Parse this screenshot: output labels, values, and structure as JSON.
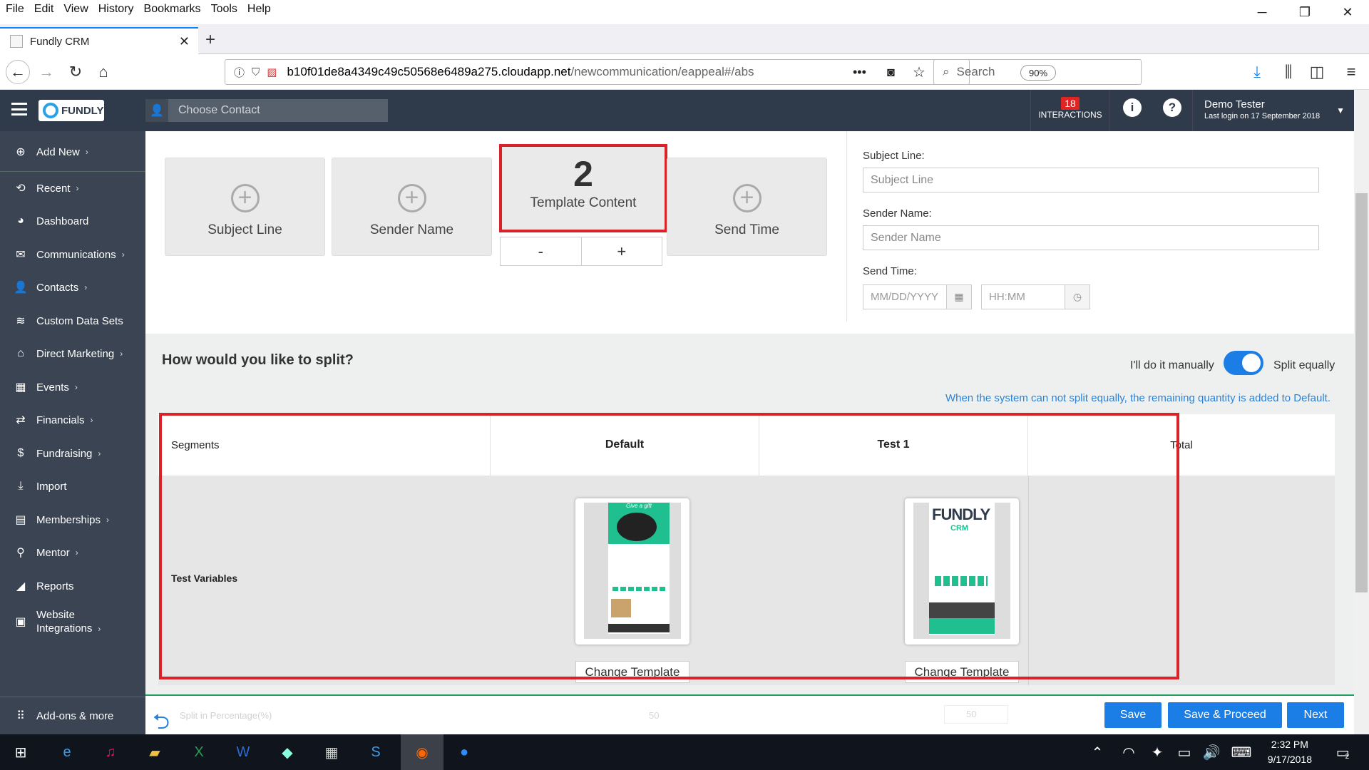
{
  "browser": {
    "menu": [
      "File",
      "Edit",
      "View",
      "History",
      "Bookmarks",
      "Tools",
      "Help"
    ],
    "tab_title": "Fundly CRM",
    "url_host": "b10f01de8a4349c49c50568e6489a275.cloudapp.net",
    "url_path": "/newcommunication/eappeal#/abs",
    "zoom": "90%",
    "search_placeholder": "Search",
    "window_controls": [
      "─",
      "❐",
      "✕"
    ]
  },
  "header": {
    "logo": "FUNDLY",
    "contact_placeholder": "Choose Contact",
    "interactions_count": "18",
    "interactions_label": "INTERACTIONS",
    "user_name": "Demo Tester",
    "last_login": "Last login on 17 September 2018"
  },
  "sidebar": {
    "items": [
      {
        "label": "Add New",
        "icon": "plus-circle-icon",
        "chevron": true
      },
      {
        "label": "Recent",
        "icon": "history-icon",
        "chevron": true
      },
      {
        "label": "Dashboard",
        "icon": "dashboard-icon",
        "chevron": false
      },
      {
        "label": "Communications",
        "icon": "envelope-icon",
        "chevron": true
      },
      {
        "label": "Contacts",
        "icon": "user-icon",
        "chevron": true
      },
      {
        "label": "Custom Data Sets",
        "icon": "database-icon",
        "chevron": false
      },
      {
        "label": "Direct Marketing",
        "icon": "bank-icon",
        "chevron": true
      },
      {
        "label": "Events",
        "icon": "calendar-icon",
        "chevron": true
      },
      {
        "label": "Financials",
        "icon": "money-icon",
        "chevron": true
      },
      {
        "label": "Fundraising",
        "icon": "dollar-icon",
        "chevron": true
      },
      {
        "label": "Import",
        "icon": "download-icon",
        "chevron": false
      },
      {
        "label": "Memberships",
        "icon": "id-card-icon",
        "chevron": true
      },
      {
        "label": "Mentor",
        "icon": "mentor-icon",
        "chevron": true
      },
      {
        "label": "Reports",
        "icon": "chart-icon",
        "chevron": false
      },
      {
        "label": "Website",
        "label2": "Integrations",
        "icon": "website-icon",
        "chevron": true
      }
    ],
    "addons": "Add-ons & more"
  },
  "variables": {
    "subject_tile": "Subject Line",
    "sender_tile": "Sender Name",
    "template_count": "2",
    "template_tile": "Template Content",
    "send_time_tile": "Send Time",
    "minus": "-",
    "plus": "+"
  },
  "form": {
    "subject_label": "Subject Line:",
    "subject_placeholder": "Subject Line",
    "sender_label": "Sender Name:",
    "sender_placeholder": "Sender Name",
    "send_time_label": "Send Time:",
    "date_placeholder": "MM/DD/YYYY",
    "time_placeholder": "HH:MM"
  },
  "split": {
    "question": "How would you like to split?",
    "manual": "I'll do it manually",
    "equal": "Split equally",
    "toggle_on": true,
    "hint": "When the system can not split equally, the remaining quantity is added to Default."
  },
  "table": {
    "headers": [
      "Segments",
      "Default",
      "Test 1",
      "Total"
    ],
    "row_label": "Test Variables",
    "change_template": "Change Template",
    "thumb_default_title": "Give a gift",
    "thumb_test_title": "FUNDLY",
    "thumb_test_sub": "CRM"
  },
  "footer": {
    "ghost_text": "Split in Percentage(%)",
    "ghost_default": "50",
    "ghost_test": "50",
    "save": "Save",
    "save_proceed": "Save & Proceed",
    "next": "Next"
  },
  "taskbar": {
    "time": "2:32 PM",
    "date": "9/17/2018",
    "notifications": "2"
  },
  "colors": {
    "header_bg": "#2f3b4a",
    "sidebar_bg": "#3a4452",
    "accent": "#1a7ee6",
    "highlight_border": "#d9222a",
    "badge": "#e02424"
  }
}
